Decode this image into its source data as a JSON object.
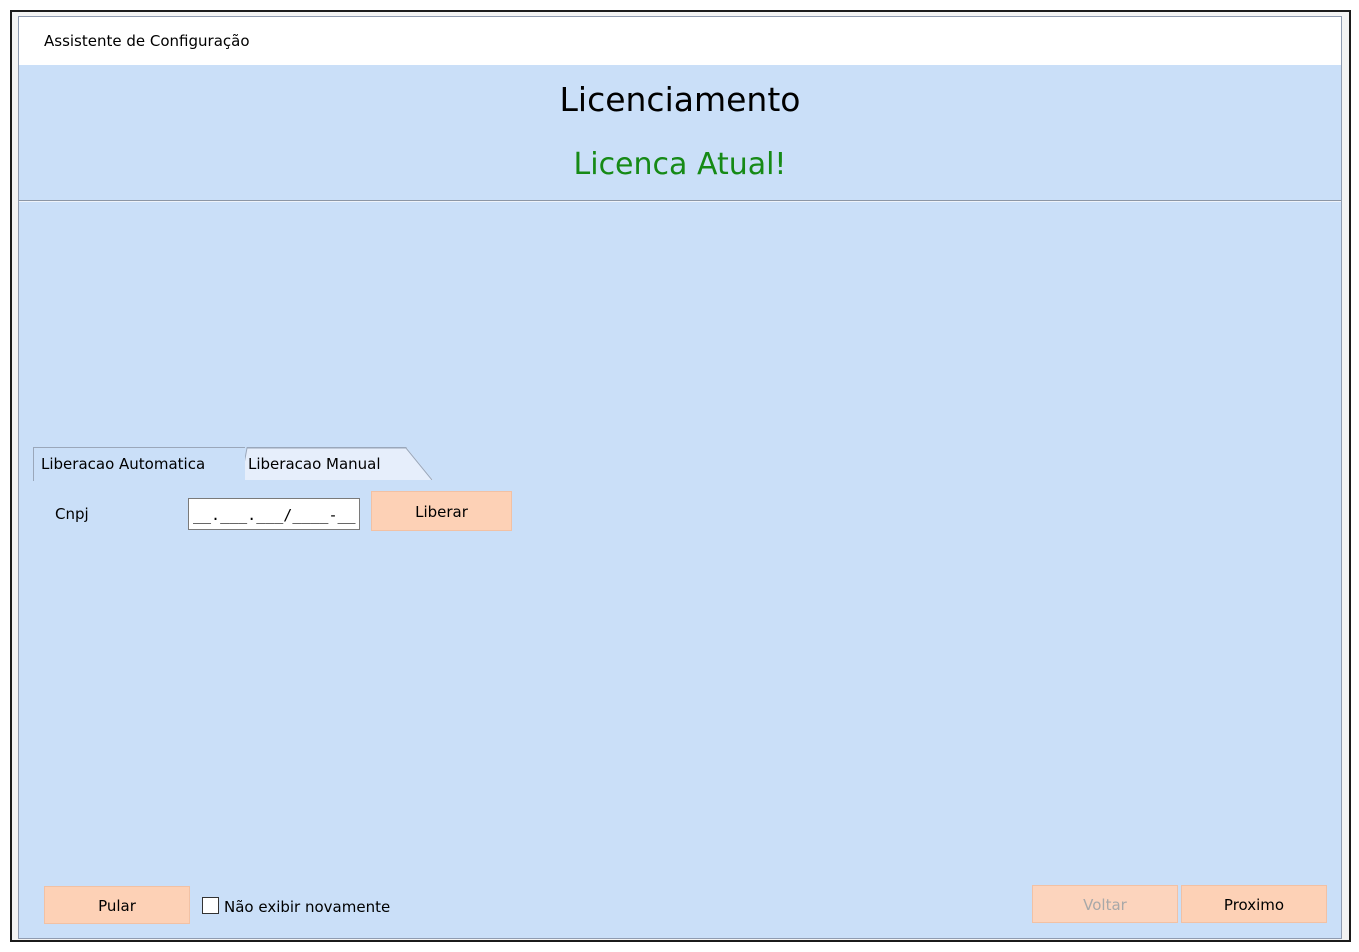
{
  "window": {
    "title": "Assistente de Configuração"
  },
  "header": {
    "title": "Licenciamento",
    "status": "Licenca Atual!",
    "status_color": "#168a16"
  },
  "tabs": [
    {
      "label": "Liberacao Automatica",
      "active": true
    },
    {
      "label": "Liberacao Manual",
      "active": false
    }
  ],
  "form": {
    "cnpj_label": "Cnpj",
    "cnpj_value": "__.___.___/____-__",
    "liberar_label": "Liberar"
  },
  "footer": {
    "skip_label": "Pular",
    "dont_show_label": "Não exibir novamente",
    "dont_show_checked": false,
    "back_label": "Voltar",
    "back_enabled": false,
    "next_label": "Proximo"
  },
  "colors": {
    "background": "#cadff8",
    "button": "#fdd1b6"
  }
}
